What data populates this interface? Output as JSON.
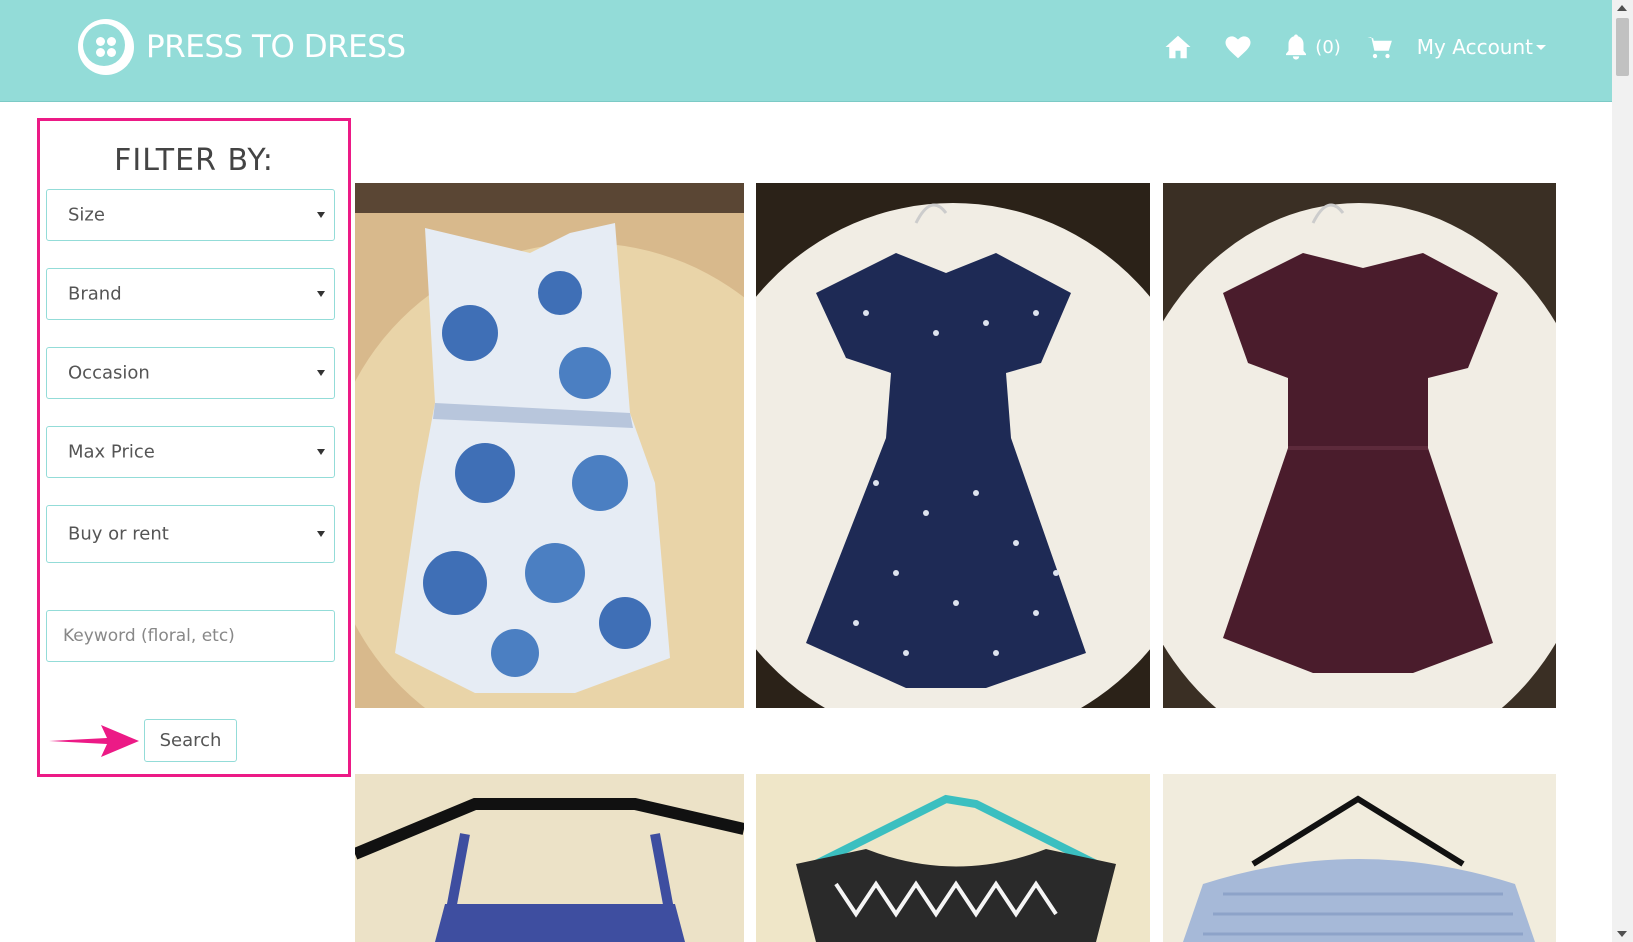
{
  "brand": {
    "name": "PRESS TO DRESS",
    "logo": "button-logo"
  },
  "nav": {
    "icons": [
      "home-icon",
      "heart-icon",
      "bell-icon",
      "cart-icon"
    ],
    "notification_count": "(0)",
    "account_label": "My Account"
  },
  "filter": {
    "title": "FILTER BY:",
    "selects": [
      "Size",
      "Brand",
      "Occasion",
      "Max Price",
      "Buy or rent"
    ],
    "keyword_placeholder": "Keyword (floral, etc)",
    "search_label": "Search"
  },
  "colors": {
    "header": "#93dcd8",
    "highlight": "#ec1a86",
    "white": "#ffffff"
  },
  "products": [
    {
      "name": "blue floral sleeveless dress",
      "color": "#b9cde0"
    },
    {
      "name": "navy bird print dress",
      "color": "#1f2a52"
    },
    {
      "name": "burgundy dress",
      "color": "#4f1e2e"
    },
    {
      "name": "blue patterned top",
      "color": "#3e4ea0"
    },
    {
      "name": "black and white geometric top",
      "color": "#222222"
    },
    {
      "name": "light blue striped top",
      "color": "#a6b9d8"
    }
  ]
}
